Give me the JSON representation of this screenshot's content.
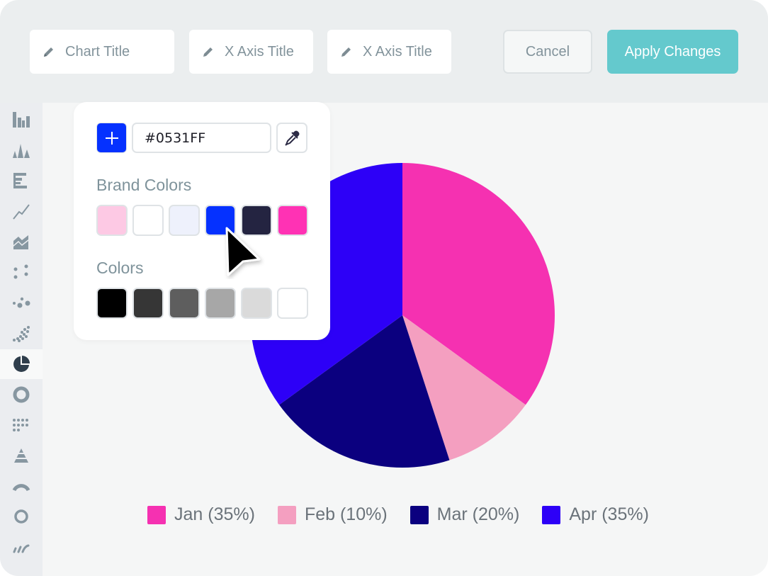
{
  "toolbar": {
    "chart_title_placeholder": "Chart Title",
    "x_axis_title_placeholder": "X Axis Title",
    "x_axis_title_2_placeholder": "X Axis Title",
    "cancel_label": "Cancel",
    "apply_label": "Apply Changes",
    "pencil_icon": "pencil-icon"
  },
  "sidebar": {
    "items": [
      {
        "name": "column-chart",
        "icon": "column-chart-icon"
      },
      {
        "name": "histogram",
        "icon": "histogram-icon"
      },
      {
        "name": "bar-chart",
        "icon": "horizontal-bar-icon"
      },
      {
        "name": "line-chart",
        "icon": "line-chart-icon"
      },
      {
        "name": "area-chart",
        "icon": "area-chart-icon"
      },
      {
        "name": "scatter-chart",
        "icon": "scatter-icon"
      },
      {
        "name": "bubble-chart",
        "icon": "bubble-icon"
      },
      {
        "name": "dense-scatter",
        "icon": "dense-scatter-icon"
      },
      {
        "name": "pie-chart",
        "icon": "pie-chart-icon",
        "active": true
      },
      {
        "name": "donut-chart",
        "icon": "donut-icon"
      },
      {
        "name": "dot-matrix",
        "icon": "dot-matrix-icon"
      },
      {
        "name": "pyramid-chart",
        "icon": "pyramid-icon"
      },
      {
        "name": "gauge-chart",
        "icon": "gauge-icon"
      },
      {
        "name": "ring-chart",
        "icon": "ring-icon"
      },
      {
        "name": "sparkline",
        "icon": "sparkline-icon"
      }
    ]
  },
  "color_picker": {
    "hex_value": "#0531FF",
    "add_icon": "plus-icon",
    "eyedropper_icon": "eyedropper-icon",
    "brand_colors_label": "Brand Colors",
    "brand_colors": [
      "#fdc9e4",
      "#ffffff",
      "#eef1fc",
      "#0531ff",
      "#242441",
      "#ff32b4"
    ],
    "colors_label": "Colors",
    "colors": [
      "#000000",
      "#363636",
      "#5e5e5e",
      "#a7a7a7",
      "#dadada",
      "#ffffff"
    ]
  },
  "chart_data": {
    "type": "pie",
    "title": "",
    "categories": [
      "Jan",
      "Feb",
      "Mar",
      "Apr"
    ],
    "values": [
      35,
      10,
      20,
      35
    ],
    "colors": [
      "#f531b1",
      "#f49fc0",
      "#0b007f",
      "#2d00f7"
    ],
    "legend": [
      "Jan (35%)",
      "Feb (10%)",
      "Mar (20%)",
      "Apr (35%)"
    ],
    "legend_position": "bottom",
    "start_angle": "12 o'clock, clockwise"
  }
}
